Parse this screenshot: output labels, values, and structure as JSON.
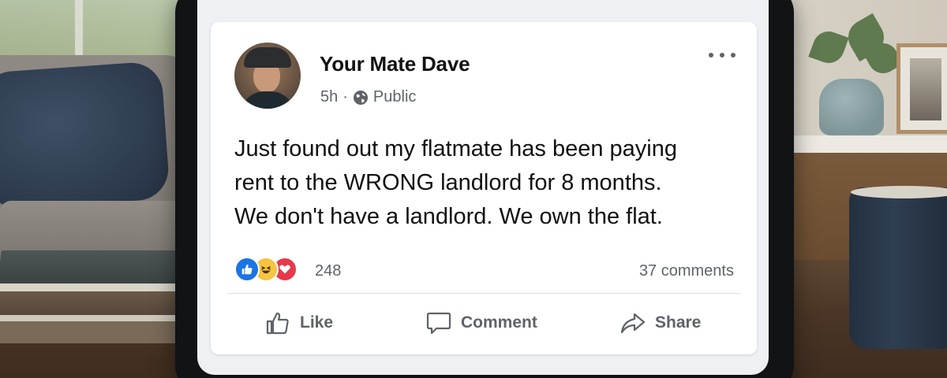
{
  "post": {
    "author_name": "Your Mate Dave",
    "timestamp": "5h",
    "separator": "·",
    "audience": "Public",
    "text_lines": [
      "Just found out my flatmate has been paying",
      "rent to the WRONG landlord for 8 months.",
      "We don't have a landlord. We own the flat."
    ],
    "reactions": {
      "types": [
        "like-icon",
        "haha-icon",
        "love-icon"
      ],
      "count": "248"
    },
    "comments_label": "37 comments",
    "actions": {
      "like": "Like",
      "comment": "Comment",
      "share": "Share"
    }
  },
  "colors": {
    "like_blue": "#1b74e4",
    "haha_yellow": "#f7c440",
    "love_red": "#e8394a",
    "secondary_text": "#5f6368",
    "primary_text": "#111111"
  }
}
